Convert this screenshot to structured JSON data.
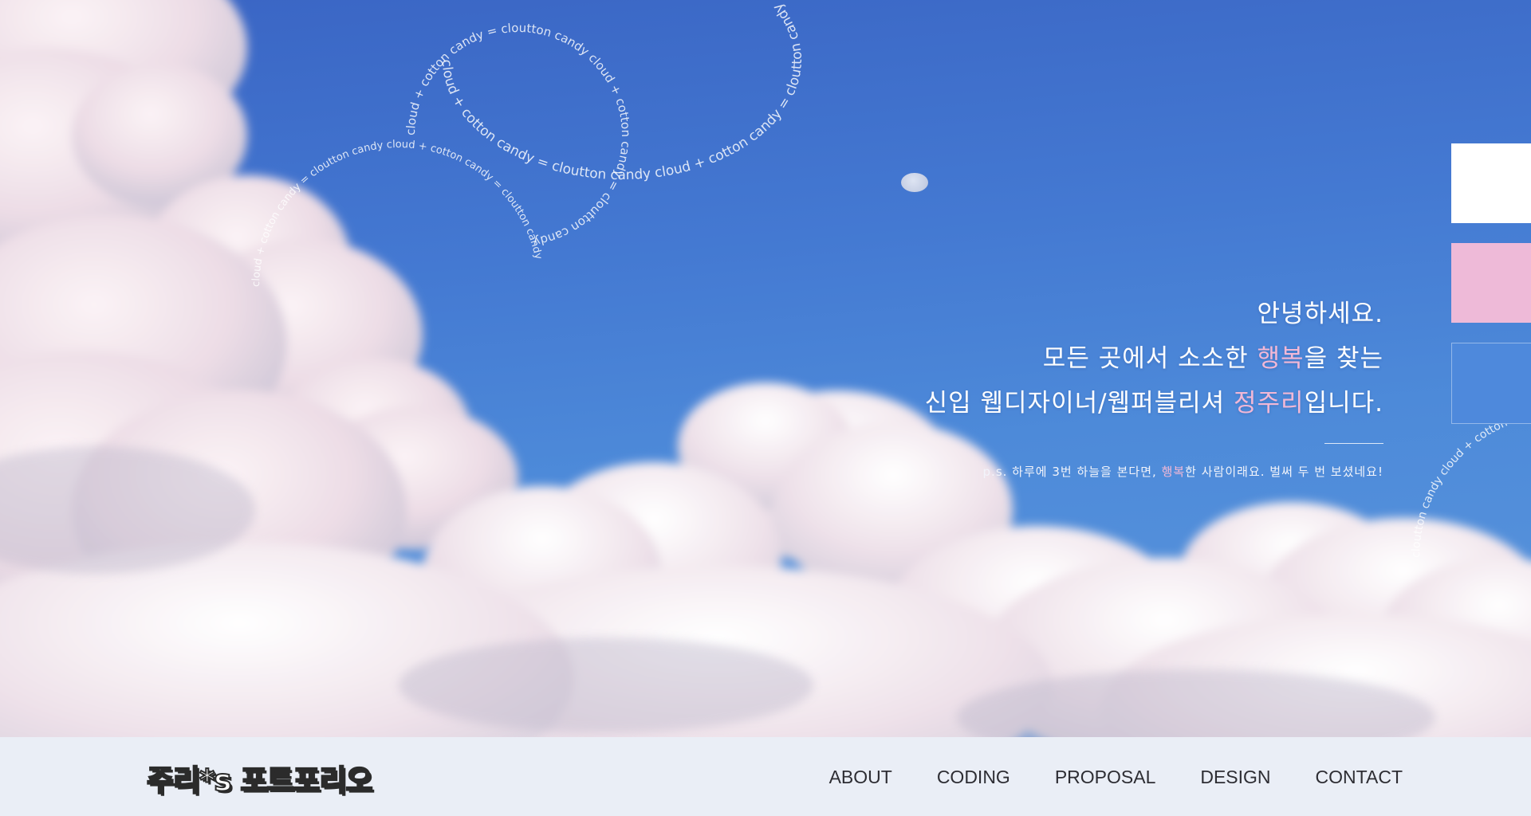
{
  "hero": {
    "intro_line1": "안녕하세요.",
    "intro_line2_pre": "모든 곳에서 소소한 ",
    "intro_line2_hl": "행복",
    "intro_line2_post": "을 찾는",
    "intro_line3_pre": "신입 웹디자이너/웹퍼블리셔 ",
    "intro_line3_hl": "정주리",
    "intro_line3_post": "입니다.",
    "ps_pre": "p.s. 하루에 3번 하늘을 본다면, ",
    "ps_hl": "행복",
    "ps_post": "한 사람이래요. 벌써 두 번 보셨네요!",
    "ring_text_a": "cloud + cotton candy = cloutton candy  cloud + cotton candy = cloutton candy  ",
    "ring_text_b": "cloud + cotton candy = cloutton candy  cloud + cotton candy = cloutton candy  ",
    "ring_text_c": "cloud + cotton candy = cloutton candy  cloud + cotton candy = cloutton candy  ",
    "ring_text_d": "cloutton candy  cloud + cotton candy  "
  },
  "side_tabs": [
    "white",
    "pink",
    "blue"
  ],
  "colors": {
    "sky": "#4479d2",
    "highlight_pink": "#f2b8d6",
    "tab_white": "#ffffff",
    "tab_pink": "#eebad8",
    "tab_blue": "#4e89dc",
    "nav_bg": "#eaeef6"
  },
  "nav": {
    "logo": "주리*s 포트포리오",
    "links": [
      "ABOUT",
      "CODING",
      "PROPOSAL",
      "DESIGN",
      "CONTACT"
    ]
  }
}
